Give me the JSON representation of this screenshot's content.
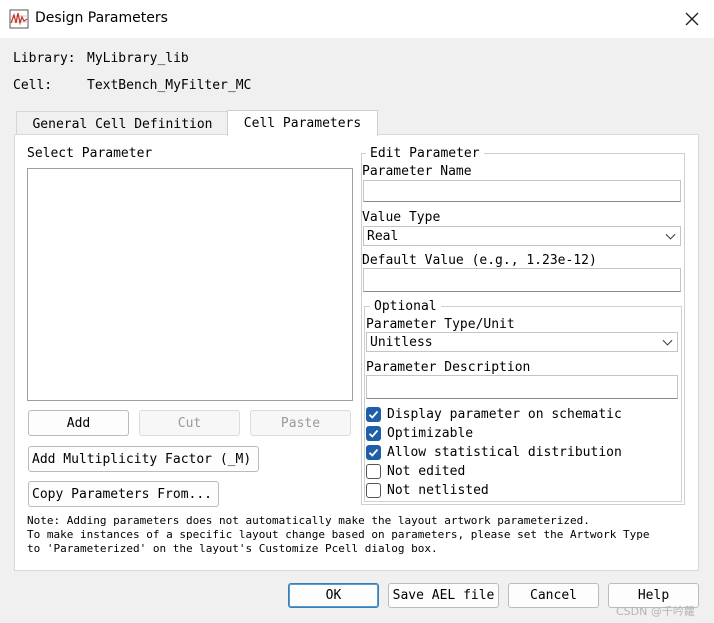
{
  "window": {
    "title": "Design Parameters",
    "icon": "graph-icon",
    "close_icon": "close-icon"
  },
  "info": {
    "library_label": "Library:",
    "library_value": "MyLibrary_lib",
    "cell_label": "Cell:",
    "cell_value": "TextBench_MyFilter_MC"
  },
  "tabs": [
    {
      "label": "General Cell Definition",
      "active": false
    },
    {
      "label": "Cell Parameters",
      "active": true
    }
  ],
  "select_param": {
    "label": "Select Parameter",
    "items": [],
    "buttons": {
      "add": "Add",
      "cut": "Cut",
      "paste": "Paste"
    },
    "add_multiplicity": "Add Multiplicity Factor (_M)",
    "copy_params": "Copy Parameters From..."
  },
  "edit_param": {
    "legend": "Edit Parameter",
    "name_label": "Parameter Name",
    "name_value": "",
    "value_type_label": "Value Type",
    "value_type_selected": "Real",
    "default_value_label": "Default Value (e.g., 1.23e-12)",
    "default_value": "",
    "optional": {
      "legend": "Optional",
      "type_unit_label": "Parameter Type/Unit",
      "type_unit_selected": "Unitless",
      "description_label": "Parameter Description",
      "description_value": "",
      "checkboxes": [
        {
          "label": "Display parameter on schematic",
          "checked": true
        },
        {
          "label": "Optimizable",
          "checked": true
        },
        {
          "label": "Allow statistical distribution",
          "checked": true
        },
        {
          "label": "Not edited",
          "checked": false
        },
        {
          "label": "Not netlisted",
          "checked": false
        }
      ]
    }
  },
  "note": {
    "line1": "Note: Adding parameters does not automatically make the layout artwork parameterized.",
    "line2": "To make instances of a specific layout change based on parameters, please set the Artwork Type",
    "line3": "to 'Parameterized' on the layout's Customize Pcell dialog box."
  },
  "footer": {
    "ok": "OK",
    "save_ael": "Save AEL file",
    "cancel": "Cancel",
    "help": "Help"
  },
  "watermark": "CSDN @千吟蘿"
}
